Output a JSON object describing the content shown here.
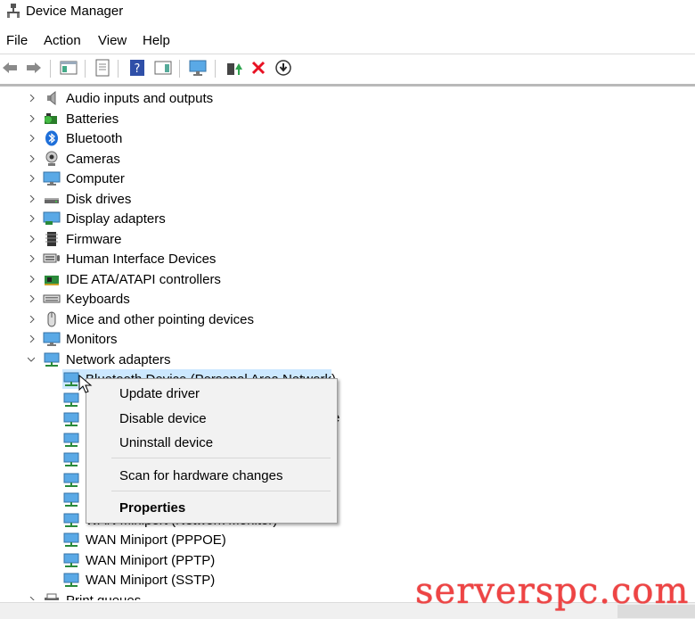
{
  "window": {
    "title": "Device Manager"
  },
  "menu": {
    "file": "File",
    "action": "Action",
    "view": "View",
    "help": "Help"
  },
  "tree": {
    "categories": [
      "Audio inputs and outputs",
      "Batteries",
      "Bluetooth",
      "Cameras",
      "Computer",
      "Disk drives",
      "Display adapters",
      "Firmware",
      "Human Interface Devices",
      "IDE ATA/ATAPI controllers",
      "Keyboards",
      "Mice and other pointing devices",
      "Monitors",
      "Network adapters"
    ],
    "network_children_visible": {
      "selected_partial": "Bluetooth Device (Personal Area Network)",
      "partial_right_letter": "e",
      "partial_row": "WAN Miniport (Network Monitor)",
      "wan_pppoe": "WAN Miniport (PPPOE)",
      "wan_pptp": "WAN Miniport (PPTP)",
      "wan_sstp": "WAN Miniport (SSTP)"
    },
    "bottom_partial": "Print queues"
  },
  "context_menu": {
    "update": "Update driver",
    "disable": "Disable device",
    "uninstall": "Uninstall device",
    "scan": "Scan for hardware changes",
    "properties": "Properties"
  },
  "watermark": "serverspc.com",
  "colors": {
    "selection": "#cce8ff",
    "accent": "#0078d7",
    "delete": "#e81123",
    "watermark": "#e44444"
  }
}
